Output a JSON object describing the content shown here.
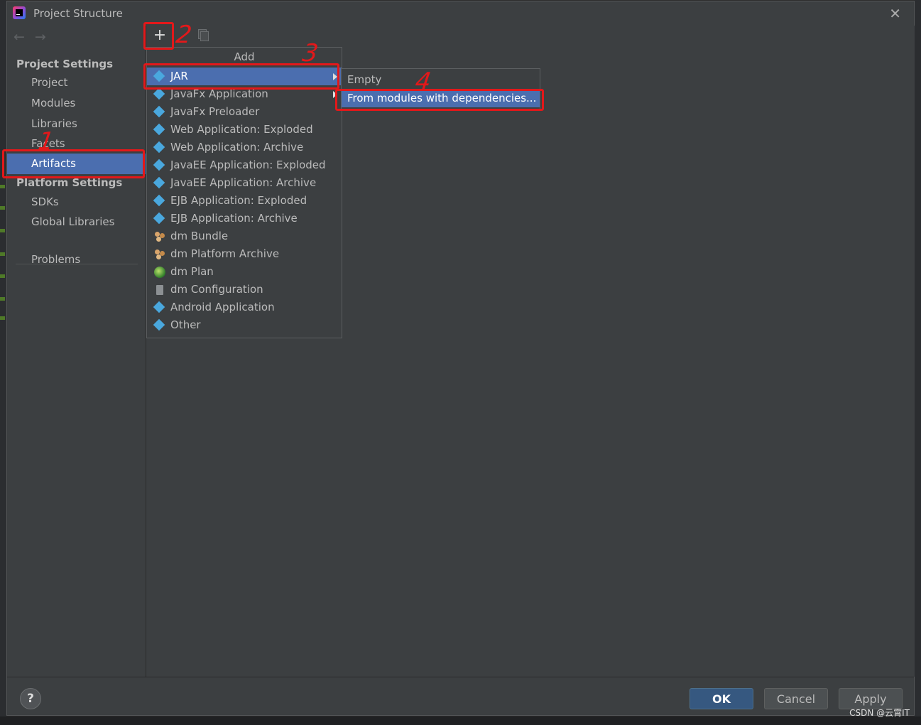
{
  "window": {
    "title": "Project Structure"
  },
  "nav": {
    "project_settings_header": "Project Settings",
    "project_items": [
      "Project",
      "Modules",
      "Libraries",
      "Facets",
      "Artifacts"
    ],
    "selected": "Artifacts",
    "platform_settings_header": "Platform Settings",
    "platform_items": [
      "SDKs",
      "Global Libraries"
    ],
    "problems": "Problems"
  },
  "toolbar": {
    "add_symbol": "+",
    "copy_icon": "copy-icon"
  },
  "add_menu": {
    "title": "Add",
    "items": [
      {
        "label": "JAR",
        "icon": "jar-icon",
        "has_submenu": true,
        "selected": true
      },
      {
        "label": "JavaFx Application",
        "icon": "javafx-icon",
        "has_submenu": true
      },
      {
        "label": "JavaFx Preloader",
        "icon": "javafx-icon"
      },
      {
        "label": "Web Application: Exploded",
        "icon": "web-exploded-icon"
      },
      {
        "label": "Web Application: Archive",
        "icon": "web-archive-icon"
      },
      {
        "label": "JavaEE Application: Exploded",
        "icon": "javaee-exploded-icon"
      },
      {
        "label": "JavaEE Application: Archive",
        "icon": "javaee-archive-icon"
      },
      {
        "label": "EJB Application: Exploded",
        "icon": "ejb-exploded-icon"
      },
      {
        "label": "EJB Application: Archive",
        "icon": "ejb-archive-icon"
      },
      {
        "label": "dm Bundle",
        "icon": "dm-bundle-icon"
      },
      {
        "label": "dm Platform Archive",
        "icon": "dm-platform-icon"
      },
      {
        "label": "dm Plan",
        "icon": "dm-plan-icon"
      },
      {
        "label": "dm Configuration",
        "icon": "dm-config-icon"
      },
      {
        "label": "Android Application",
        "icon": "android-icon"
      },
      {
        "label": "Other",
        "icon": "other-icon"
      }
    ]
  },
  "jar_submenu": {
    "items": [
      "Empty",
      "From modules with dependencies..."
    ],
    "selected": "From modules with dependencies..."
  },
  "annotations": {
    "marks": [
      "1",
      "2",
      "3",
      "4"
    ],
    "color": "#e3181a"
  },
  "footer": {
    "help": "?",
    "ok": "OK",
    "cancel": "Cancel",
    "apply": "Apply"
  },
  "watermark": "CSDN @云霄IT",
  "colors": {
    "selection": "#4b6eaf",
    "panel": "#3c3f41",
    "ok_button": "#365880"
  }
}
